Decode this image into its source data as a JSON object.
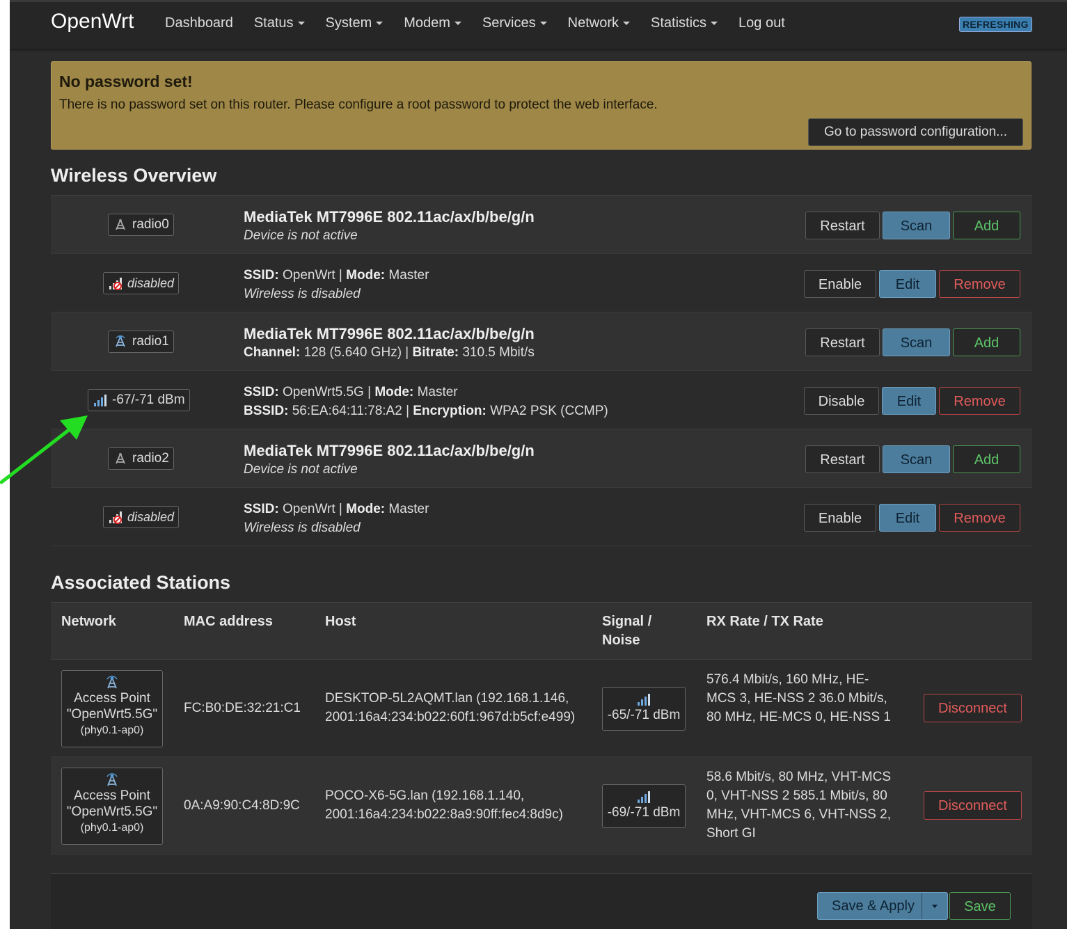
{
  "header": {
    "brand": "OpenWrt",
    "nav": [
      {
        "label": "Dashboard",
        "dropdown": false
      },
      {
        "label": "Status",
        "dropdown": true
      },
      {
        "label": "System",
        "dropdown": true
      },
      {
        "label": "Modem",
        "dropdown": true
      },
      {
        "label": "Services",
        "dropdown": true
      },
      {
        "label": "Network",
        "dropdown": true
      },
      {
        "label": "Statistics",
        "dropdown": true
      },
      {
        "label": "Log out",
        "dropdown": false
      }
    ],
    "indicator": "REFRESHING"
  },
  "alert": {
    "title": "No password set!",
    "message": "There is no password set on this router. Please configure a root password to protect the web interface.",
    "button": "Go to password configuration..."
  },
  "wireless": {
    "title": "Wireless Overview",
    "rows": [
      {
        "kind": "radio",
        "badge_icon": "radio-icon",
        "badge": "radio0",
        "title": "MediaTek MT7996E 802.11ac/ax/b/be/g/n",
        "status": "Device is not active",
        "buttons": [
          "Restart",
          "Scan",
          "Add"
        ]
      },
      {
        "kind": "iface",
        "badge_icon": "signal-disabled-icon",
        "badge": "disabled",
        "ssid_label": "SSID:",
        "ssid": "OpenWrt",
        "mode_label": "Mode:",
        "mode": "Master",
        "status": "Wireless is disabled",
        "buttons": [
          "Enable",
          "Edit",
          "Remove"
        ]
      },
      {
        "kind": "radio-active",
        "badge_icon": "radio-active-icon",
        "badge": "radio1",
        "title": "MediaTek MT7996E 802.11ac/ax/b/be/g/n",
        "channel_label": "Channel:",
        "channel": "128 (5.640 GHz)",
        "bitrate_label": "Bitrate:",
        "bitrate": "310.5 Mbit/s",
        "buttons": [
          "Restart",
          "Scan",
          "Add"
        ]
      },
      {
        "kind": "iface-active",
        "badge_icon": "signal-icon",
        "badge": "-67/-71 dBm",
        "ssid_label": "SSID:",
        "ssid": "OpenWrt5.5G",
        "mode_label": "Mode:",
        "mode": "Master",
        "bssid_label": "BSSID:",
        "bssid": "56:EA:64:11:78:A2",
        "enc_label": "Encryption:",
        "encryption": "WPA2 PSK (CCMP)",
        "buttons": [
          "Disable",
          "Edit",
          "Remove"
        ]
      },
      {
        "kind": "radio",
        "badge_icon": "radio-icon",
        "badge": "radio2",
        "title": "MediaTek MT7996E 802.11ac/ax/b/be/g/n",
        "status": "Device is not active",
        "buttons": [
          "Restart",
          "Scan",
          "Add"
        ]
      },
      {
        "kind": "iface",
        "badge_icon": "signal-disabled-icon",
        "badge": "disabled",
        "ssid_label": "SSID:",
        "ssid": "OpenWrt",
        "mode_label": "Mode:",
        "mode": "Master",
        "status": "Wireless is disabled",
        "buttons": [
          "Enable",
          "Edit",
          "Remove"
        ]
      }
    ]
  },
  "stations": {
    "title": "Associated Stations",
    "headers": [
      "Network",
      "MAC address",
      "Host",
      "Signal / Noise",
      "RX Rate / TX Rate"
    ],
    "rows": [
      {
        "ap_line1": "Access Point",
        "ap_line2": "\"OpenWrt5.5G\"",
        "ap_line3": "(phy0.1-ap0)",
        "mac": "FC:B0:DE:32:21:C1",
        "host": "DESKTOP-5L2AQMT.lan (192.168.1.146, 2001:16a4:234:b022:60f1:967d:b5cf:e499)",
        "signal": "-65/-71 dBm",
        "rate": "576.4 Mbit/s, 160 MHz, HE-MCS 3, HE-NSS 2 36.0 Mbit/s, 80 MHz, HE-MCS 0, HE-NSS 1",
        "button": "Disconnect"
      },
      {
        "ap_line1": "Access Point",
        "ap_line2": "\"OpenWrt5.5G\"",
        "ap_line3": "(phy0.1-ap0)",
        "mac": "0A:A9:90:C4:8D:9C",
        "host": "POCO-X6-5G.lan (192.168.1.140, 2001:16a4:234:b022:8a9:90ff:fec4:8d9c)",
        "signal": "-69/-71 dBm",
        "rate": "58.6 Mbit/s, 80 MHz, VHT-MCS 0, VHT-NSS 2 585.1 Mbit/s, 80 MHz, VHT-MCS 6, VHT-NSS 2, Short GI",
        "button": "Disconnect"
      }
    ]
  },
  "footer": {
    "save_apply": "Save & Apply",
    "save": "Save"
  },
  "colors": {
    "background": "#2b2b2b",
    "header": "#262626",
    "alert": "#9e8747",
    "action_button": "#4d7d9c",
    "positive": "#5cc468",
    "negative": "#e25b5b",
    "annotation_arrow": "#22dd22"
  }
}
